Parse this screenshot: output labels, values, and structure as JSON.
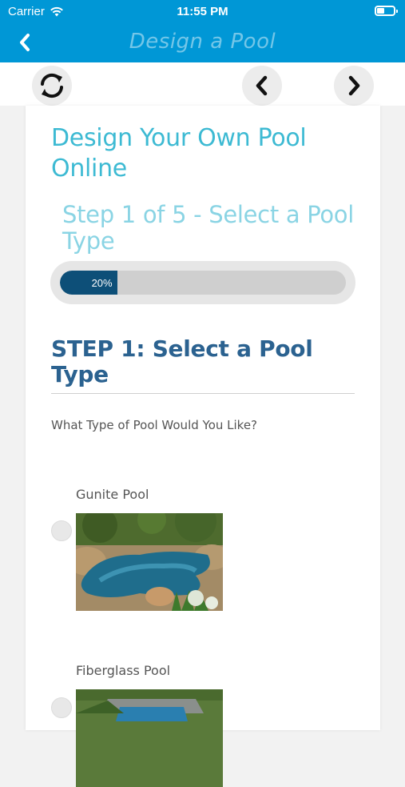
{
  "status": {
    "carrier": "Carrier",
    "time": "11:55 PM"
  },
  "nav": {
    "title": "Design a Pool"
  },
  "page": {
    "heading": "Design Your Own Pool Online",
    "step_heading": "Step 1 of 5 - Select a Pool Type",
    "progress": {
      "label": "20%",
      "value": 0.2
    },
    "section_title": "STEP 1: Select a Pool Type",
    "question": "What Type of Pool Would You Like?",
    "options": [
      {
        "label": "Gunite Pool"
      },
      {
        "label": "Fiberglass Pool"
      }
    ]
  },
  "colors": {
    "accent": "#0097d6",
    "heading": "#3dbad3",
    "progress_fill": "#0d4f78",
    "section_title": "#2b6290"
  },
  "icons": [
    "wifi-icon",
    "battery-icon",
    "back-chevron-icon",
    "refresh-icon",
    "chevron-left-icon",
    "chevron-right-icon"
  ]
}
